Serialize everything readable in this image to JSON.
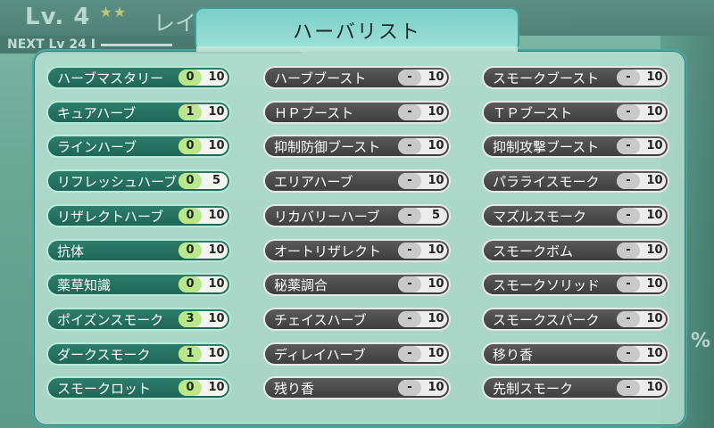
{
  "background": {
    "level_text": "Lv.  4",
    "level_stars": "★★",
    "name_partial": "レイブラ",
    "next_text": "NEXT Lv 24 I",
    "side_percent": "%"
  },
  "title": "ハーバリスト",
  "columns": [
    {
      "style": "green",
      "items": [
        {
          "label": "ハーブマスタリー",
          "current": "0",
          "max": "10"
        },
        {
          "label": "キュアハーブ",
          "current": "1",
          "max": "10"
        },
        {
          "label": "ラインハーブ",
          "current": "0",
          "max": "10"
        },
        {
          "label": "リフレッシュハーブ",
          "current": "0",
          "max": "5"
        },
        {
          "label": "リザレクトハーブ",
          "current": "0",
          "max": "10"
        },
        {
          "label": "抗体",
          "current": "0",
          "max": "10"
        },
        {
          "label": "薬草知識",
          "current": "0",
          "max": "10"
        },
        {
          "label": "ポイズンスモーク",
          "current": "3",
          "max": "10"
        },
        {
          "label": "ダークスモーク",
          "current": "1",
          "max": "10"
        },
        {
          "label": "スモークロット",
          "current": "0",
          "max": "10"
        }
      ]
    },
    {
      "style": "dark",
      "items": [
        {
          "label": "ハーブブースト",
          "current": "-",
          "max": "10"
        },
        {
          "label": "ＨＰブースト",
          "current": "-",
          "max": "10"
        },
        {
          "label": "抑制防御ブースト",
          "current": "-",
          "max": "10"
        },
        {
          "label": "エリアハーブ",
          "current": "-",
          "max": "10"
        },
        {
          "label": "リカバリーハーブ",
          "current": "-",
          "max": "5"
        },
        {
          "label": "オートリザレクト",
          "current": "-",
          "max": "10"
        },
        {
          "label": "秘薬調合",
          "current": "-",
          "max": "10"
        },
        {
          "label": "チェイスハーブ",
          "current": "-",
          "max": "10"
        },
        {
          "label": "ディレイハーブ",
          "current": "-",
          "max": "10"
        },
        {
          "label": "残り香",
          "current": "-",
          "max": "10"
        }
      ]
    },
    {
      "style": "dark",
      "items": [
        {
          "label": "スモークブースト",
          "current": "-",
          "max": "10"
        },
        {
          "label": "ＴＰブースト",
          "current": "-",
          "max": "10"
        },
        {
          "label": "抑制攻撃ブースト",
          "current": "-",
          "max": "10"
        },
        {
          "label": "パラライスモーク",
          "current": "-",
          "max": "10"
        },
        {
          "label": "マズルスモーク",
          "current": "-",
          "max": "10"
        },
        {
          "label": "スモークボム",
          "current": "-",
          "max": "10"
        },
        {
          "label": "スモークソリッド",
          "current": "-",
          "max": "10"
        },
        {
          "label": "スモークスパーク",
          "current": "-",
          "max": "10"
        },
        {
          "label": "移り香",
          "current": "-",
          "max": "10"
        },
        {
          "label": "先制スモーク",
          "current": "-",
          "max": "10"
        }
      ]
    }
  ]
}
